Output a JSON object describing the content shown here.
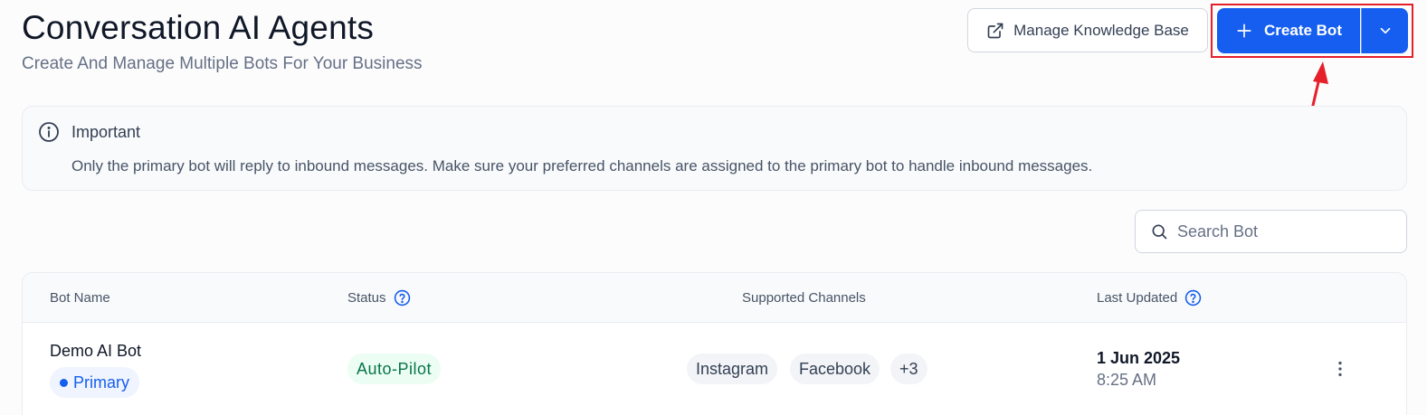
{
  "header": {
    "title": "Conversation AI Agents",
    "subtitle": "Create And Manage Multiple Bots For Your Business",
    "manage_kb_label": "Manage Knowledge Base",
    "create_bot_label": "Create Bot"
  },
  "alert": {
    "title": "Important",
    "body": "Only the primary bot will reply to inbound messages. Make sure your preferred channels are assigned to the primary bot to handle inbound messages."
  },
  "search": {
    "placeholder": "Search Bot"
  },
  "table": {
    "columns": [
      "Bot Name",
      "Status",
      "Supported Channels",
      "Last Updated"
    ],
    "rows": [
      {
        "bot_name": "Demo AI Bot",
        "badge": "Primary",
        "status": "Auto-Pilot",
        "channels": [
          "Instagram",
          "Facebook",
          "+3"
        ],
        "date": "1 Jun 2025",
        "time": "8:25 AM"
      }
    ]
  },
  "colors": {
    "primary": "#155eef",
    "annotation": "#e5202b",
    "status_green": "#067647"
  }
}
